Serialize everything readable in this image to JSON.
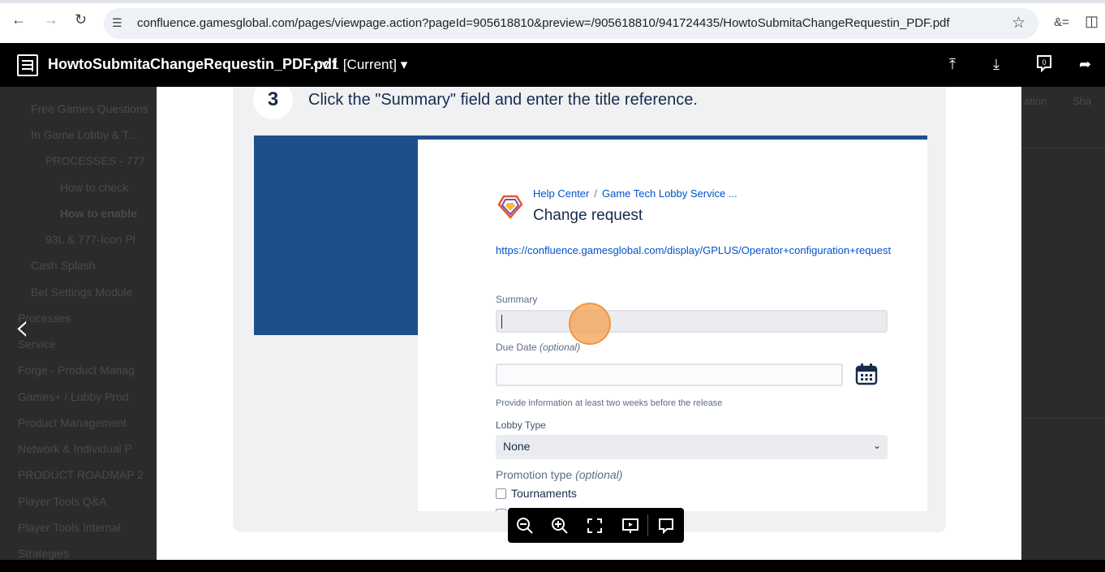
{
  "browser": {
    "url": "confluence.gamesglobal.com/pages/viewpage.action?pageId=905618810&preview=/905618810/941724435/HowtoSubmitaChangeRequestin_PDF.pdf",
    "extension_label": "&="
  },
  "viewer": {
    "file_name": "HowtoSubmitaChangeRequestin_PDF.pdf",
    "version_label": "v.1 [Current]",
    "comment_count": "0"
  },
  "background_tree": [
    "Free Games Questions",
    "In Game Lobby & T...",
    "PROCESSES - 777",
    "How to check",
    "How to enable",
    "93L & 777-Icon Pl",
    "Cash Splash",
    "Bet Settings Module",
    "Processes",
    "Service",
    "Forge - Product Manag",
    "Games+ / Lobby Prod",
    "Product Management",
    "Network & Individual P",
    "PRODUCT ROADMAP 2",
    "Player Tools Q&A",
    "Player Tools Internal",
    "Strategies"
  ],
  "background_right": {
    "item1": "ation",
    "item2": "Sha"
  },
  "step": {
    "number": "3",
    "instruction": "Click the \"Summary\" field and enter the title reference."
  },
  "form": {
    "breadcrumb_home": "Help Center",
    "breadcrumb_sep": "/",
    "breadcrumb_service": "Game Tech Lobby Service ...",
    "title": "Change request",
    "link": "https://confluence.gamesglobal.com/display/GPLUS/Operator+configuration+request",
    "summary_label": "Summary",
    "due_date_label": "Due Date",
    "optional_label": "(optional)",
    "due_date_hint": "Provide information at least two weeks before the release",
    "lobby_type_label": "Lobby Type",
    "lobby_type_value": "None",
    "promotion_label": "Promotion type",
    "promotion_option_1": "Tournaments"
  },
  "colors": {
    "accent_blue": "#1d4f8a",
    "link_blue": "#0052cc",
    "click_marker": "#f4a050"
  }
}
